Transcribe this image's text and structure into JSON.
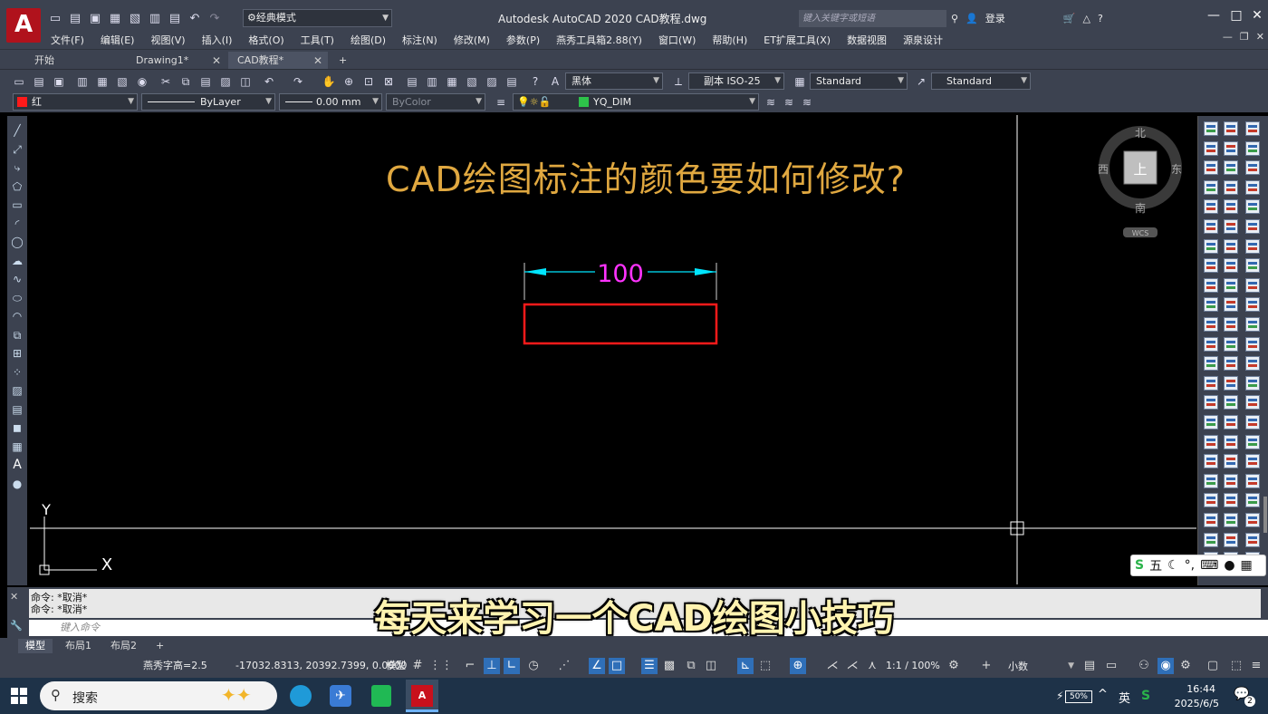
{
  "app": {
    "logo": "A",
    "title": "Autodesk AutoCAD 2020    CAD教程.dwg",
    "workspace": "经典模式",
    "search_placeholder": "键入关键字或短语",
    "login": "登录"
  },
  "menu": [
    "文件(F)",
    "编辑(E)",
    "视图(V)",
    "插入(I)",
    "格式(O)",
    "工具(T)",
    "绘图(D)",
    "标注(N)",
    "修改(M)",
    "参数(P)",
    "燕秀工具箱2.88(Y)",
    "窗口(W)",
    "帮助(H)",
    "ET扩展工具(X)",
    "数据视图",
    "源泉设计"
  ],
  "doc_tabs": [
    {
      "label": "开始",
      "closable": false
    },
    {
      "label": "Drawing1*",
      "closable": true
    },
    {
      "label": "CAD教程*",
      "closable": true,
      "active": true
    }
  ],
  "toolbar": {
    "text_font": "黑体",
    "dim_style": "副本 ISO-25",
    "table_style": "Standard",
    "mleader_style": "Standard"
  },
  "properties": {
    "color": "红",
    "linetype": "ByLayer",
    "lineweight": "0.00 mm",
    "plotstyle": "ByColor",
    "layer": "YQ_DIM"
  },
  "drawing": {
    "title": "CAD绘图标注的颜色要如何修改?",
    "dimension_value": "100",
    "ucs_x": "X",
    "ucs_y": "Y"
  },
  "viewcube": {
    "north": "北",
    "south": "南",
    "east": "东",
    "west": "西",
    "face": "上",
    "wcs": "WCS"
  },
  "command": {
    "history": [
      "命令: *取消*",
      "命令: *取消*"
    ],
    "placeholder": "键入命令"
  },
  "subtitle": "每天来学习一个CAD绘图小技巧",
  "layout_tabs": [
    {
      "label": "模型",
      "active": true
    },
    {
      "label": "布局1"
    },
    {
      "label": "布局2"
    }
  ],
  "status": {
    "text_height": "燕秀字高=2.5",
    "coords": "-17032.8313, 20392.7399, 0.0000",
    "space": "模型",
    "scale": "1:1 / 100%",
    "units": "小数"
  },
  "ime": {
    "mode": "五"
  },
  "taskbar": {
    "search": "搜索",
    "battery": "50%",
    "lang": "英",
    "time": "16:44",
    "date": "2025/6/5",
    "notifications": "2"
  },
  "colors": {
    "rect": "#ff1a1a",
    "dimension_line": "#00e5ff",
    "dimension_text": "#ff33ff",
    "title": "#e0a840",
    "accent": "#2f6fb8"
  }
}
